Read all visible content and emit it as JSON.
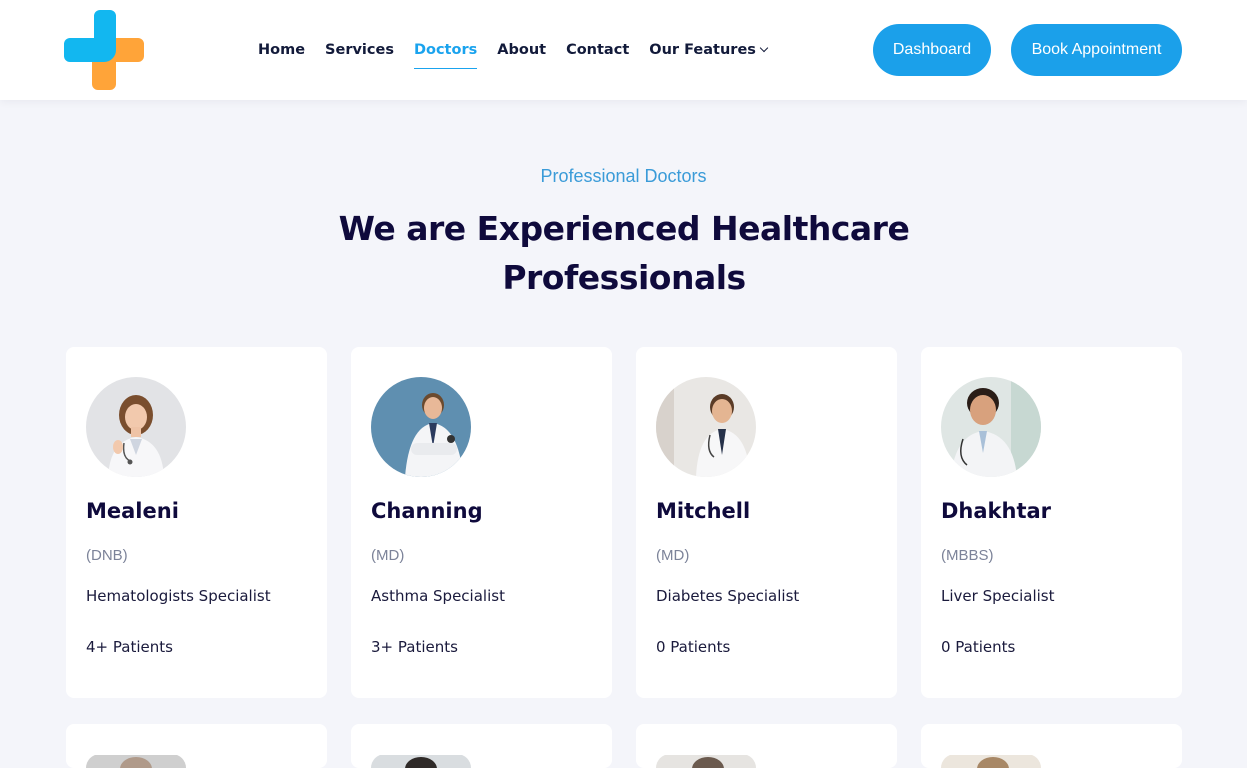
{
  "brand": {
    "logo_icon": "medical-cross-logo",
    "colors": {
      "blue": "#12b7f0",
      "orange": "#ff9f2e"
    }
  },
  "nav": {
    "items": [
      {
        "label": "Home",
        "active": false
      },
      {
        "label": "Services",
        "active": false
      },
      {
        "label": "Doctors",
        "active": true
      },
      {
        "label": "About",
        "active": false
      },
      {
        "label": "Contact",
        "active": false
      },
      {
        "label": "Our Features",
        "active": false,
        "dropdown": true
      }
    ]
  },
  "header": {
    "dashboard_label": "Dashboard",
    "book_label": "Book Appointment"
  },
  "section": {
    "eyebrow": "Professional Doctors",
    "title_line1": "We are Experienced Healthcare",
    "title_line2": "Professionals"
  },
  "doctors": [
    {
      "name": "Mealeni",
      "degree": "(DNB)",
      "specialty": "Hematologists Specialist",
      "patients": "4+ Patients"
    },
    {
      "name": "Channing",
      "degree": "(MD)",
      "specialty": "Asthma Specialist",
      "patients": "3+ Patients"
    },
    {
      "name": "Mitchell",
      "degree": "(MD)",
      "specialty": "Diabetes Specialist",
      "patients": "0 Patients"
    },
    {
      "name": "Dhakhtar",
      "degree": "(MBBS)",
      "specialty": "Liver Specialist",
      "patients": "0 Patients"
    }
  ],
  "theme": {
    "accent": "#1ba0ea",
    "heading": "#0f0a3c",
    "muted": "#7c8399",
    "page_bg": "#f4f5fa"
  }
}
